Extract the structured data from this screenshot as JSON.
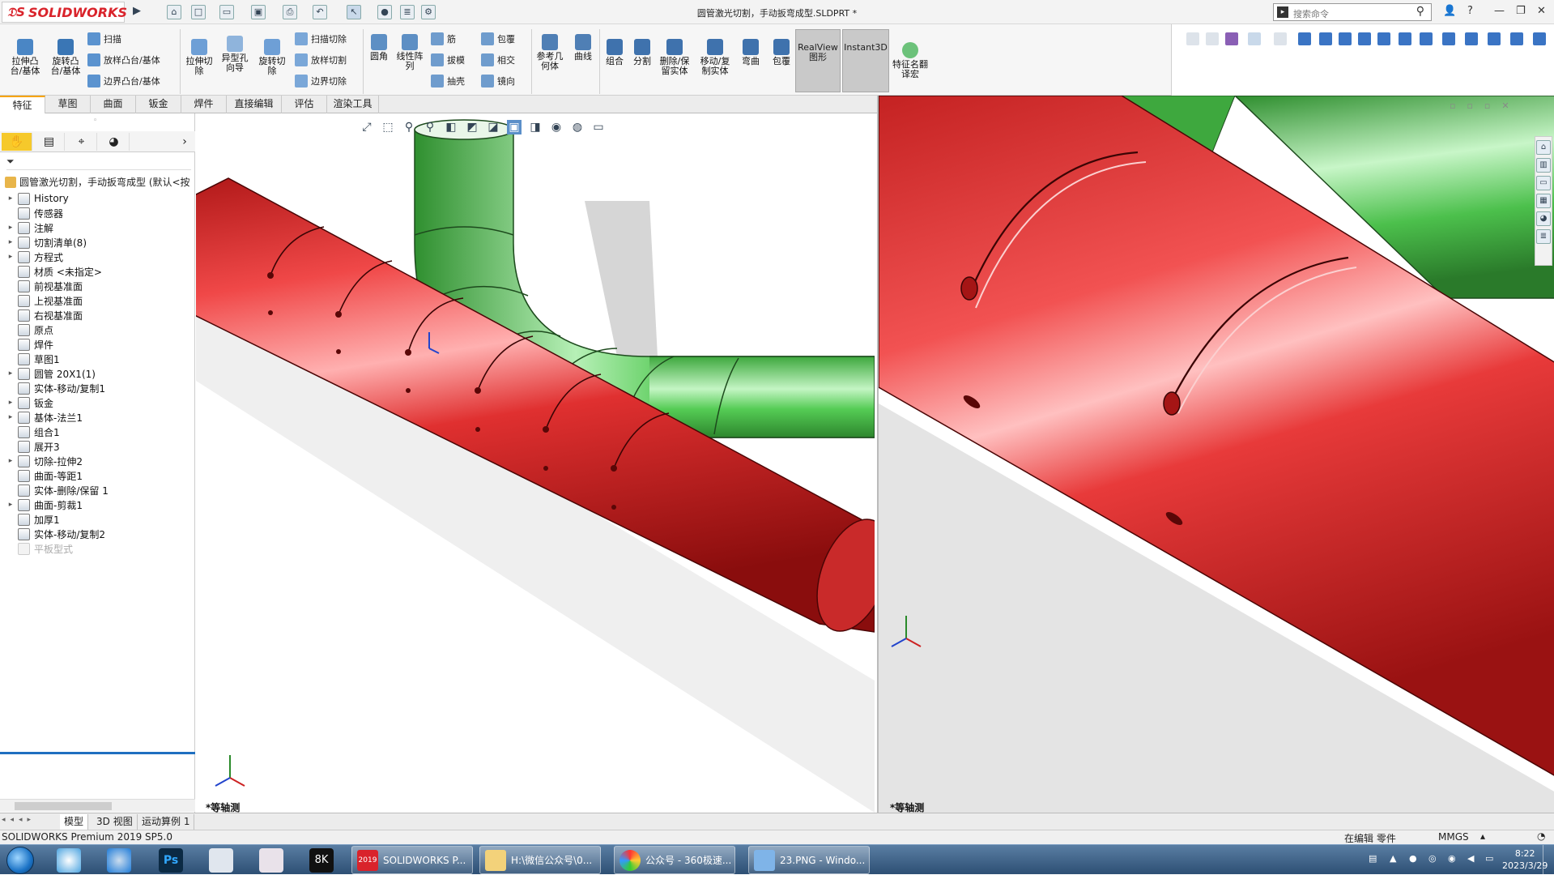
{
  "app": {
    "logo_text": "SOLIDWORKS",
    "window_title": "圆管激光切割，手动扳弯成型.SLDPRT *"
  },
  "search": {
    "placeholder": "搜索命令"
  },
  "command_manager": {
    "extrude_boss": "拉伸凸台/基体",
    "revolve_boss": "旋转凸台/基体",
    "sweep": "扫描",
    "loft": "放样凸台/基体",
    "boundary": "边界凸台/基体",
    "extrude_cut": "拉伸切除",
    "hole_wizard": "异型孔向导",
    "revolve_cut": "旋转切除",
    "sweep_cut": "扫描切除",
    "loft_cut": "放样切割",
    "boundary_cut": "边界切除",
    "fillet": "圆角",
    "linear_pattern": "线性阵列",
    "rib": "筋",
    "draft": "拔模",
    "shell": "抽壳",
    "wrap": "包覆",
    "intersect": "相交",
    "mirror": "镜向",
    "ref_geometry": "参考几何体",
    "curves": "曲线",
    "combine": "组合",
    "split": "分割",
    "delete_keep": "删除/保留实体",
    "move_copy": "移动/复制实体",
    "flex": "弯曲",
    "wrap2": "包覆",
    "realview": "RealView图形",
    "instant3d": "Instant3D",
    "feature_translate": "特征名翻译宏"
  },
  "tabs": [
    "特征",
    "草图",
    "曲面",
    "钣金",
    "焊件",
    "直接编辑",
    "评估",
    "渲染工具"
  ],
  "feature_tree": {
    "root": "圆管激光切割，手动扳弯成型  (默认<按",
    "items": [
      {
        "label": "History",
        "arrow": "▸"
      },
      {
        "label": "传感器",
        "arrow": ""
      },
      {
        "label": "注解",
        "arrow": "▸"
      },
      {
        "label": "切割清单(8)",
        "arrow": "▸"
      },
      {
        "label": "方程式",
        "arrow": "▸"
      },
      {
        "label": "材质 <未指定>",
        "arrow": ""
      },
      {
        "label": "前视基准面",
        "arrow": ""
      },
      {
        "label": "上视基准面",
        "arrow": ""
      },
      {
        "label": "右视基准面",
        "arrow": ""
      },
      {
        "label": "原点",
        "arrow": ""
      },
      {
        "label": "焊件",
        "arrow": ""
      },
      {
        "label": "草图1",
        "arrow": ""
      },
      {
        "label": "圆管 20X1(1)",
        "arrow": "▸"
      },
      {
        "label": "实体-移动/复制1",
        "arrow": ""
      },
      {
        "label": "钣金",
        "arrow": "▸"
      },
      {
        "label": "基体-法兰1",
        "arrow": "▸"
      },
      {
        "label": "组合1",
        "arrow": ""
      },
      {
        "label": "展开3",
        "arrow": ""
      },
      {
        "label": "切除-拉伸2",
        "arrow": "▸"
      },
      {
        "label": "曲面-等距1",
        "arrow": ""
      },
      {
        "label": "实体-删除/保留 1",
        "arrow": ""
      },
      {
        "label": "曲面-剪裁1",
        "arrow": "▸"
      },
      {
        "label": "加厚1",
        "arrow": ""
      },
      {
        "label": "实体-移动/复制2",
        "arrow": ""
      },
      {
        "label": "平板型式",
        "arrow": ""
      }
    ]
  },
  "viewports": {
    "left_label": "*等轴测",
    "right_label": "*等轴测"
  },
  "bottom_tabs": [
    "模型",
    "3D 视图",
    "运动算例 1"
  ],
  "status": {
    "version": "SOLIDWORKS Premium 2019 SP5.0",
    "editing": "在编辑 零件",
    "units": "MMGS"
  },
  "taskbar": {
    "tasks": [
      "SOLIDWORKS P...",
      "H:\\微信公众号\\0...",
      "公众号 - 360极速...",
      "23.PNG - Windo..."
    ],
    "sw_badge": "2019",
    "time": "8:22",
    "date": "2023/3/29"
  },
  "colors": {
    "pipe_red": "#e23a3a",
    "pipe_green": "#3fbf3f",
    "accent": "#f6a300",
    "brand": "#d9232b"
  }
}
